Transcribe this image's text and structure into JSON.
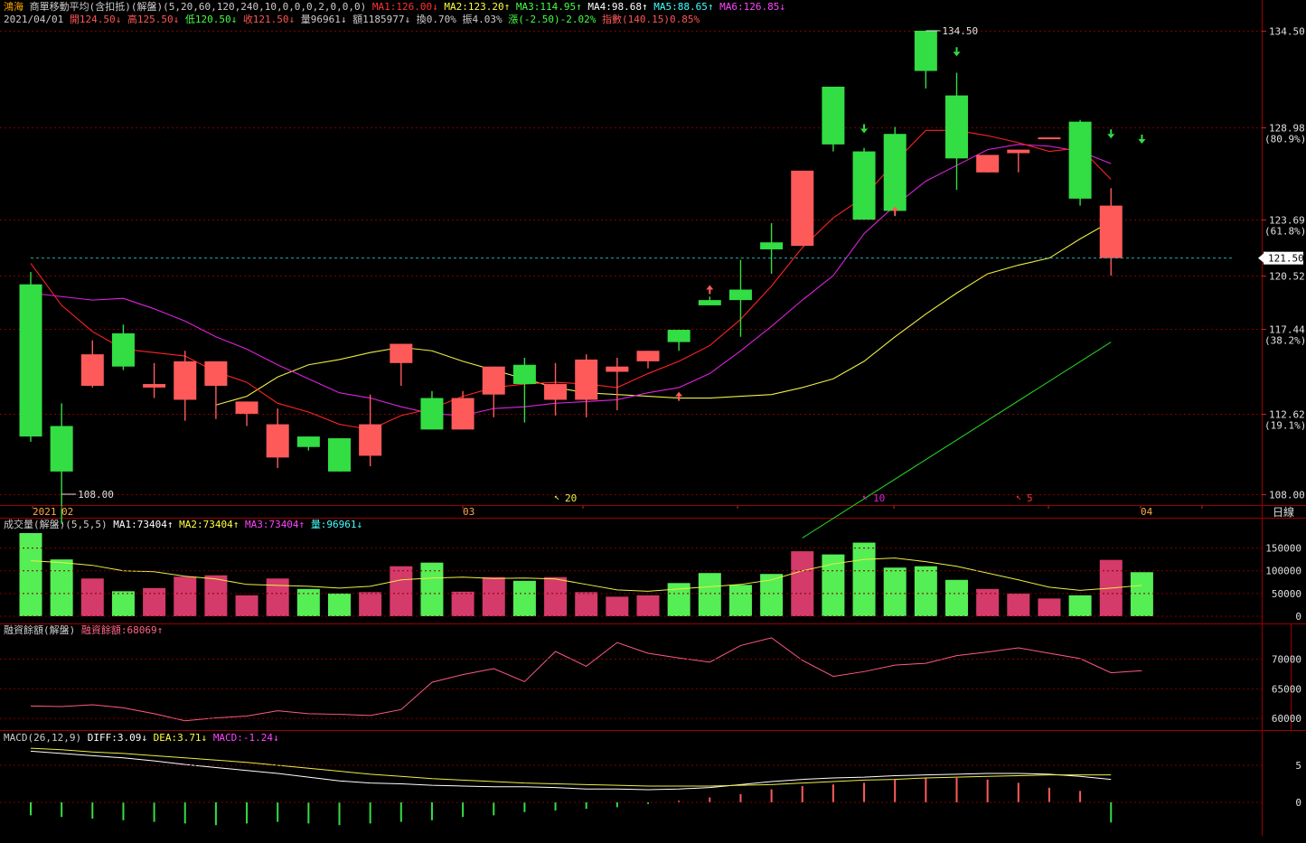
{
  "header": {
    "stock": "鴻海",
    "indicator": "商單移動平均(含扣抵)(解盤)(5,20,60,120,240,10,0,0,0,2,0,0,0)",
    "ma1": "MA1:126.00↓",
    "ma2": "MA2:123.20↑",
    "ma3": "MA3:114.95↑",
    "ma4": "MA4:98.68↑",
    "ma5": "MA5:88.65↑",
    "ma6": "MA6:126.85↓",
    "date": "2021/04/01",
    "open": "開124.50↓",
    "high": "高125.50↓",
    "low": "低120.50↓",
    "close": "收121.50↓",
    "volume": "量96961↓",
    "amount": "額1185977↓",
    "turnover": "換0.70%",
    "amplitude": "振4.03%",
    "change": "漲(-2.50)-2.02%",
    "index": "指數(140.15)0.85%"
  },
  "price_axis": {
    "labels": [
      {
        "v": 134.5,
        "text": "134.50",
        "sub": ""
      },
      {
        "v": 128.98,
        "text": "128.98",
        "sub": "(80.9%)"
      },
      {
        "v": 123.69,
        "text": "123.69",
        "sub": "(61.8%)"
      },
      {
        "v": 120.52,
        "text": "120.52",
        "sub": ""
      },
      {
        "v": 117.44,
        "text": "117.44",
        "sub": "(38.2%)"
      },
      {
        "v": 112.62,
        "text": "112.62",
        "sub": "(19.1%)"
      },
      {
        "v": 108.0,
        "text": "108.00",
        "sub": ""
      }
    ],
    "current": "121.50",
    "current_value": 121.5
  },
  "annotations": {
    "high": "134.50",
    "low": "108.00",
    "ma20_mark": "20",
    "ma10_mark": "10",
    "ma5_mark": "5"
  },
  "date_axis": {
    "year": "2021",
    "m02": "02",
    "m03": "03",
    "m04": "04",
    "toggle": "日線"
  },
  "volume_panel": {
    "title": "成交量(解盤)(5,5,5)",
    "ma1": "MA1:73404↑",
    "ma2": "MA2:73404↑",
    "ma3": "MA3:73404↑",
    "vol": "量:96961↓",
    "axis": [
      "150000",
      "100000",
      "50000",
      "0"
    ]
  },
  "margin_panel": {
    "title": "融資餘額(解盤)",
    "value": "融資餘額:68069↑",
    "axis": [
      "70000",
      "65000",
      "60000"
    ]
  },
  "macd_panel": {
    "title": "MACD(26,12,9)",
    "diff": "DIFF:3.09↓",
    "dea": "DEA:3.71↓",
    "macd": "MACD:-1.24↓",
    "axis": [
      "5",
      "0"
    ]
  },
  "colors": {
    "up": "#ff5a5a",
    "down": "#33dd44",
    "vol_up": "#d43a6a",
    "vol_down": "#55ee55",
    "ma5": "#ff2222",
    "ma10": "#dd22dd",
    "ma20": "#eeee44",
    "ma60": "#22cc22",
    "grid": "#800000",
    "current": "#22aaaa"
  },
  "chart_data": {
    "type": "candlestick",
    "candles": [
      {
        "o": 120.0,
        "h": 120.7,
        "c": 111.3,
        "l": 111.0
      },
      {
        "o": 111.9,
        "h": 113.2,
        "c": 109.3,
        "l": 106.3
      },
      {
        "o": 114.2,
        "h": 116.8,
        "c": 116.0,
        "l": 114.1
      },
      {
        "o": 117.2,
        "h": 117.7,
        "c": 115.3,
        "l": 115.1
      },
      {
        "o": 114.1,
        "h": 115.5,
        "c": 114.3,
        "l": 113.5
      },
      {
        "o": 113.4,
        "h": 116.2,
        "c": 115.6,
        "l": 112.2
      },
      {
        "o": 114.2,
        "h": 115.4,
        "c": 115.6,
        "l": 112.3
      },
      {
        "o": 112.6,
        "h": 113.0,
        "c": 113.3,
        "l": 111.9
      },
      {
        "o": 110.1,
        "h": 112.9,
        "c": 112.0,
        "l": 109.5
      },
      {
        "o": 111.3,
        "h": 111.1,
        "c": 110.7,
        "l": 110.5
      },
      {
        "o": 111.2,
        "h": 110.9,
        "c": 109.3,
        "l": 109.3
      },
      {
        "o": 110.2,
        "h": 113.7,
        "c": 112.0,
        "l": 109.6
      },
      {
        "o": 115.5,
        "h": 115.4,
        "c": 116.6,
        "l": 114.2
      },
      {
        "o": 113.5,
        "h": 113.9,
        "c": 111.7,
        "l": 111.8
      },
      {
        "o": 111.7,
        "h": 113.9,
        "c": 113.5,
        "l": 111.7
      },
      {
        "o": 113.7,
        "h": 114.6,
        "c": 115.3,
        "l": 112.4
      },
      {
        "o": 115.4,
        "h": 115.8,
        "c": 114.3,
        "l": 112.1
      },
      {
        "o": 113.4,
        "h": 115.5,
        "c": 114.3,
        "l": 112.5
      },
      {
        "o": 113.4,
        "h": 116.0,
        "c": 115.7,
        "l": 112.4
      },
      {
        "o": 115.0,
        "h": 115.8,
        "c": 115.3,
        "l": 112.8
      },
      {
        "o": 115.6,
        "h": 115.5,
        "c": 116.2,
        "l": 115.2
      },
      {
        "o": 117.4,
        "h": 117.4,
        "c": 116.7,
        "l": 116.2
      },
      {
        "o": 119.1,
        "h": 119.3,
        "c": 118.8,
        "l": 118.8
      },
      {
        "o": 119.7,
        "h": 121.4,
        "c": 119.1,
        "l": 117.0
      },
      {
        "o": 122.4,
        "h": 123.5,
        "c": 122.0,
        "l": 120.6
      },
      {
        "o": 122.2,
        "h": 122.7,
        "c": 126.5,
        "l": 123.4
      },
      {
        "o": 131.3,
        "h": 130.4,
        "c": 128.0,
        "l": 127.6
      },
      {
        "o": 127.6,
        "h": 127.8,
        "c": 123.7,
        "l": 124.3
      },
      {
        "o": 128.6,
        "h": 129.0,
        "c": 124.2,
        "l": 123.9
      },
      {
        "o": 134.5,
        "h": 134.5,
        "c": 132.2,
        "l": 131.2
      },
      {
        "o": 130.8,
        "h": 132.1,
        "c": 127.2,
        "l": 125.4
      },
      {
        "o": 126.4,
        "h": 126.5,
        "c": 127.4,
        "l": 126.6
      },
      {
        "o": 127.5,
        "h": 126.8,
        "c": 127.7,
        "l": 126.4
      },
      {
        "o": 128.4,
        "h": 128.4,
        "c": 128.4,
        "l": 129.0
      },
      {
        "o": 129.3,
        "h": 129.4,
        "c": 124.9,
        "l": 124.5
      },
      {
        "o": 121.5,
        "h": 125.5,
        "c": 124.5,
        "l": 120.5
      }
    ],
    "ma5": [
      121.2,
      118.8,
      117.3,
      116.3,
      116.1,
      115.9,
      115.0,
      114.4,
      113.2,
      112.7,
      112.0,
      111.7,
      112.5,
      112.9,
      113.6,
      114.1,
      114.3,
      114.4,
      114.3,
      114.1,
      114.9,
      115.6,
      116.5,
      118.0,
      119.9,
      122.1,
      123.8,
      125.0,
      127.0,
      128.8,
      128.8,
      128.5,
      128.1,
      127.6,
      127.8,
      126.0
    ],
    "ma10": [
      119.5,
      119.3,
      119.1,
      119.2,
      118.6,
      117.9,
      117.0,
      116.3,
      115.4,
      114.6,
      113.8,
      113.5,
      113.0,
      112.6,
      112.5,
      112.9,
      113.0,
      113.2,
      113.3,
      113.4,
      113.8,
      114.1,
      114.9,
      116.2,
      117.6,
      119.1,
      120.5,
      122.9,
      124.5,
      125.9,
      126.8,
      127.7,
      128.0,
      127.9,
      127.6,
      126.9
    ],
    "ma20": [
      113.1,
      113.6,
      114.7,
      115.4,
      115.7,
      116.1,
      116.4,
      116.2,
      115.6,
      115.1,
      114.6,
      114.1,
      113.8,
      113.7,
      113.6,
      113.5,
      113.5,
      113.6,
      113.7,
      114.1,
      114.6,
      115.6,
      117.0,
      118.3,
      119.5,
      120.6,
      121.1,
      121.5,
      122.6,
      123.6
    ],
    "ma60_start": {
      "index": 25,
      "value": 105.5
    },
    "ma60_end": {
      "index": 35,
      "value": 116.7
    },
    "volume": [
      183000,
      125000,
      83000,
      55000,
      62000,
      87000,
      90000,
      46000,
      83000,
      60000,
      50000,
      53000,
      110000,
      118000,
      54000,
      86000,
      78000,
      86000,
      53000,
      43000,
      46000,
      73000,
      95000,
      69000,
      93000,
      143000,
      136000,
      162000,
      107000,
      110000,
      80000,
      60000,
      50000,
      39000,
      46000,
      124000,
      96961
    ],
    "volume_ma": [
      122000,
      118000,
      112000,
      100000,
      98000,
      88000,
      82000,
      70000,
      68000,
      66000,
      62000,
      66000,
      80000,
      84000,
      86000,
      83000,
      84000,
      82000,
      70000,
      58000,
      55000,
      60000,
      65000,
      70000,
      80000,
      100000,
      115000,
      125000,
      128000,
      120000,
      110000,
      95000,
      80000,
      64000,
      57000,
      62000,
      68000
    ],
    "margin": [
      62100,
      62000,
      62300,
      61800,
      60800,
      59600,
      60100,
      60400,
      61300,
      60800,
      60700,
      60500,
      61500,
      66100,
      67400,
      68400,
      66200,
      71300,
      68800,
      72800,
      71000,
      70200,
      69500,
      72300,
      73600,
      69800,
      67100,
      67900,
      69000,
      69300,
      70600,
      71200,
      71900,
      71000,
      70100,
      67700,
      68069
    ],
    "macd_diff": [
      6.9,
      6.6,
      6.3,
      6.0,
      5.6,
      5.1,
      4.7,
      4.3,
      3.9,
      3.4,
      2.9,
      2.6,
      2.5,
      2.3,
      2.2,
      2.1,
      2.1,
      2.0,
      1.8,
      1.8,
      1.7,
      1.8,
      2.0,
      2.4,
      2.8,
      3.1,
      3.3,
      3.4,
      3.6,
      3.7,
      3.8,
      3.9,
      3.9,
      3.8,
      3.5,
      3.09
    ],
    "macd_dea": [
      7.3,
      7.1,
      6.8,
      6.6,
      6.3,
      6.0,
      5.7,
      5.4,
      5.0,
      4.6,
      4.2,
      3.8,
      3.5,
      3.2,
      3.0,
      2.8,
      2.6,
      2.5,
      2.4,
      2.3,
      2.2,
      2.2,
      2.2,
      2.3,
      2.4,
      2.6,
      2.8,
      3.0,
      3.1,
      3.3,
      3.4,
      3.5,
      3.6,
      3.7,
      3.7,
      3.71
    ],
    "macd_hist": [
      -0.8,
      -0.9,
      -1.0,
      -1.1,
      -1.2,
      -1.3,
      -1.4,
      -1.3,
      -1.2,
      -1.3,
      -1.4,
      -1.3,
      -1.2,
      -1.1,
      -0.9,
      -0.8,
      -0.6,
      -0.5,
      -0.4,
      -0.3,
      -0.1,
      0.1,
      0.3,
      0.5,
      0.8,
      1.0,
      1.1,
      1.2,
      1.4,
      1.5,
      1.5,
      1.4,
      1.2,
      0.9,
      0.7,
      -1.24
    ]
  }
}
